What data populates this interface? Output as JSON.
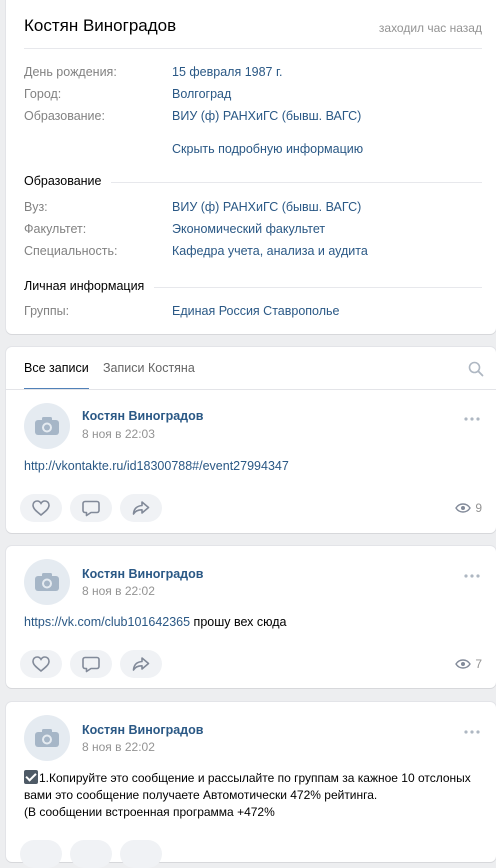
{
  "profile": {
    "name": "Костян Виноградов",
    "last_seen": "заходил час назад",
    "info": [
      {
        "label": "День рождения:",
        "value": "15 февраля 1987 г."
      },
      {
        "label": "Город:",
        "value": "Волгоград"
      },
      {
        "label": "Образование:",
        "value": "ВИУ (ф) РАНХиГС (бывш. ВАГС)"
      }
    ],
    "hide_details": "Скрыть подробную информацию",
    "education_section": "Образование",
    "education": [
      {
        "label": "Вуз:",
        "value": "ВИУ (ф) РАНХиГС (бывш. ВАГС)"
      },
      {
        "label": "Факультет:",
        "value": "Экономический факультет"
      },
      {
        "label": "Специальность:",
        "value": "Кафедра учета, анализа и аудита"
      }
    ],
    "personal_section": "Личная информация",
    "personal": [
      {
        "label": "Группы:",
        "value": "Единая Россия Ставрополье"
      }
    ]
  },
  "wall": {
    "tabs": [
      "Все записи",
      "Записи Костяна"
    ],
    "posts": [
      {
        "author": "Костян Виноградов",
        "date": "8 ноя в 22:03",
        "link": "http://vkontakte.ru/id18300788#/event27994347",
        "text": "",
        "views": "9"
      },
      {
        "author": "Костян Виноградов",
        "date": "8 ноя в 22:02",
        "link": "https://vk.com/club101642365",
        "text": " прошу вех сюда",
        "views": "7"
      },
      {
        "author": "Костян Виноградов",
        "date": "8 ноя в 22:02",
        "line1": "1.Копируйте это сообщение и рассылайте по группам за кажное 10 отслоных",
        "line2": "вами это сообщение получаете Автомотически 472% рейтинга.",
        "line3": "(В сообщении встроенная программа +472%"
      }
    ]
  },
  "colors": {
    "accent": "#2a5885",
    "tab_active": "#5181b8",
    "muted": "#939393",
    "label": "#828282"
  }
}
